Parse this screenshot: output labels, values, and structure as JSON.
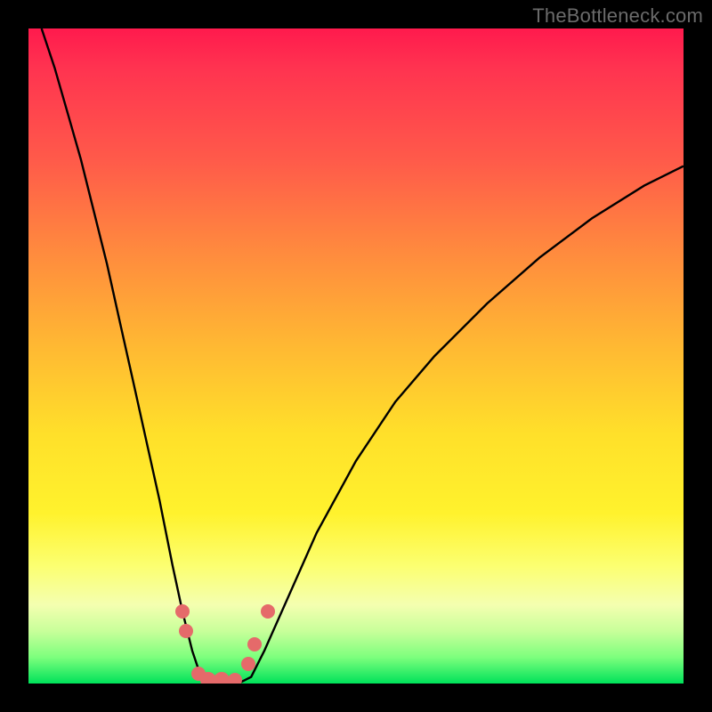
{
  "watermark": "TheBottleneck.com",
  "chart_data": {
    "type": "line",
    "title": "",
    "xlabel": "",
    "ylabel": "",
    "xlim": [
      0,
      100
    ],
    "ylim": [
      0,
      100
    ],
    "grid": false,
    "legend": false,
    "series": [
      {
        "name": "left-curve",
        "x": [
          2,
          4,
          6,
          8,
          10,
          12,
          14,
          16,
          18,
          20,
          22,
          23.5,
          25,
          26,
          27,
          28
        ],
        "values": [
          100,
          94,
          87,
          80,
          72,
          64,
          55,
          46,
          37,
          28,
          18,
          11,
          5,
          2,
          0.5,
          0
        ]
      },
      {
        "name": "right-curve",
        "x": [
          32,
          34,
          36,
          40,
          44,
          50,
          56,
          62,
          70,
          78,
          86,
          94,
          100
        ],
        "values": [
          0,
          1,
          5,
          14,
          23,
          34,
          43,
          50,
          58,
          65,
          71,
          76,
          79
        ]
      }
    ],
    "markers": [
      {
        "name": "m1",
        "x": 23.5,
        "y": 11,
        "r": 8
      },
      {
        "name": "m2",
        "x": 24.0,
        "y": 8,
        "r": 8
      },
      {
        "name": "m3",
        "x": 26.0,
        "y": 1.5,
        "r": 8
      },
      {
        "name": "m4",
        "x": 27.5,
        "y": 0.5,
        "r": 9
      },
      {
        "name": "m5",
        "x": 29.5,
        "y": 0.5,
        "r": 9
      },
      {
        "name": "m6",
        "x": 31.5,
        "y": 0.5,
        "r": 8
      },
      {
        "name": "m7",
        "x": 33.5,
        "y": 3,
        "r": 8
      },
      {
        "name": "m8",
        "x": 34.5,
        "y": 6,
        "r": 8
      },
      {
        "name": "m9",
        "x": 36.5,
        "y": 11,
        "r": 8
      }
    ],
    "colors": {
      "curve": "#000000",
      "marker": "#e56a6a",
      "gradient_top": "#ff1a4d",
      "gradient_mid": "#ffe02a",
      "gradient_bottom": "#00e25a"
    }
  }
}
